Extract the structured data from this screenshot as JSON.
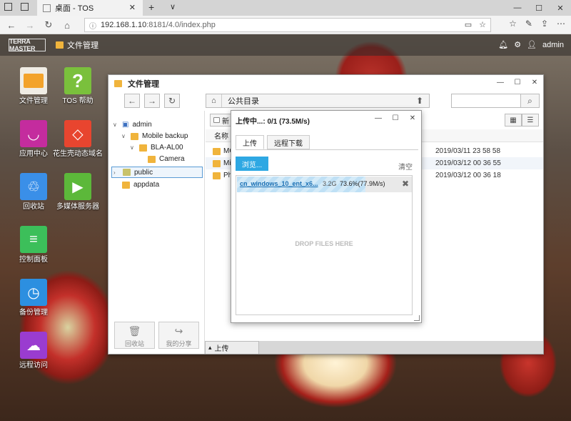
{
  "browser": {
    "tab_title": "桌面 - TOS",
    "new_tab": "+",
    "tab_menu": "∨",
    "url_host": "192.168.1.10",
    "url_path": ":8181/4.0/index.php",
    "window_controls": [
      "—",
      "☐",
      "✕"
    ]
  },
  "topbar": {
    "logo": "TERRA MASTER",
    "app_label": "文件管理",
    "user": "admin"
  },
  "desktop_icons": [
    {
      "label": "文件管理",
      "color": "#f3a32b",
      "glyph": "▭"
    },
    {
      "label": "TOS 帮助",
      "color": "#7ac03c",
      "glyph": "?"
    },
    {
      "label": "应用中心",
      "color": "#c42c9e",
      "glyph": "◡"
    },
    {
      "label": "花生壳动态域名",
      "color": "#e8452f",
      "glyph": "◇"
    },
    {
      "label": "回收站",
      "color": "#3a8fe8",
      "glyph": "♲"
    },
    {
      "label": "多媒体服务器",
      "color": "#5cb83a",
      "glyph": "▶"
    },
    {
      "label": "控制面板",
      "color": "#3cbf5a",
      "glyph": "≡"
    },
    {
      "label": "备份管理",
      "color": "#2c8fe0",
      "glyph": "◷"
    },
    {
      "label": "远程访问",
      "color": "#9a3cd0",
      "glyph": "☁"
    }
  ],
  "file_manager": {
    "title": "文件管理",
    "path": "公共目录",
    "tree": [
      {
        "label": "admin",
        "level": 0,
        "expanded": true
      },
      {
        "label": "Mobile backup",
        "level": 1,
        "expanded": true
      },
      {
        "label": "BLA-AL00",
        "level": 2,
        "expanded": true
      },
      {
        "label": "Camera",
        "level": 3,
        "expanded": false
      },
      {
        "label": "public",
        "level": 0,
        "expanded": false,
        "selected": true
      },
      {
        "label": "appdata",
        "level": 0,
        "expanded": false
      }
    ],
    "side_buttons": [
      "回收站",
      "我的分享"
    ],
    "new_button": "新",
    "column_name": "名称",
    "files": [
      {
        "name": "MC",
        "date": "2019/03/11 23 58 58"
      },
      {
        "name": "Mi",
        "date": "2019/03/12 00 36 55"
      },
      {
        "name": "Ph",
        "date": "2019/03/12 00 36 18"
      }
    ],
    "status_tab": "上传"
  },
  "upload_dialog": {
    "title": "上传中...: 0/1 (73.5M/s)",
    "tabs": [
      "上传",
      "远程下载"
    ],
    "browse_label": "浏览...",
    "clear_label": "清空",
    "item": {
      "name": "cn_windows_10_ent_x6...",
      "size": "3.2G",
      "percent_text": "73.6%(77.9M/s)",
      "percent": 73.6
    },
    "drop_text": "DROP FILES HERE"
  }
}
